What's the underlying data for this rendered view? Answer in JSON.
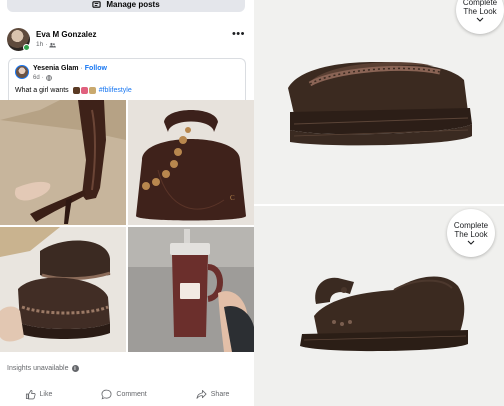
{
  "feed": {
    "manage_posts_label": "Manage posts",
    "post": {
      "author": "Eva M Gonzalez",
      "time": "1h",
      "shared": {
        "page_name": "Yesenia Glam",
        "follow_label": "Follow",
        "time": "6d",
        "caption_text": "What a girl wants",
        "hashtag": "#fblifestyle"
      },
      "insights_label": "Insights unavailable",
      "actions": {
        "like": "Like",
        "comment": "Comment",
        "share": "Share"
      }
    }
  },
  "products": {
    "complete_look_line1": "Complete",
    "complete_look_line2": "The Look"
  },
  "colors": {
    "facebook_blue": "#1877f2",
    "secondary_text": "#65676b",
    "shoe_brown": "#3b2a20",
    "online_green": "#31a24c"
  },
  "icons": [
    "manage-posts-icon",
    "friends-icon",
    "globe-icon",
    "more-options-icon",
    "info-icon",
    "like-icon",
    "comment-icon",
    "share-icon",
    "chevron-down-icon"
  ]
}
